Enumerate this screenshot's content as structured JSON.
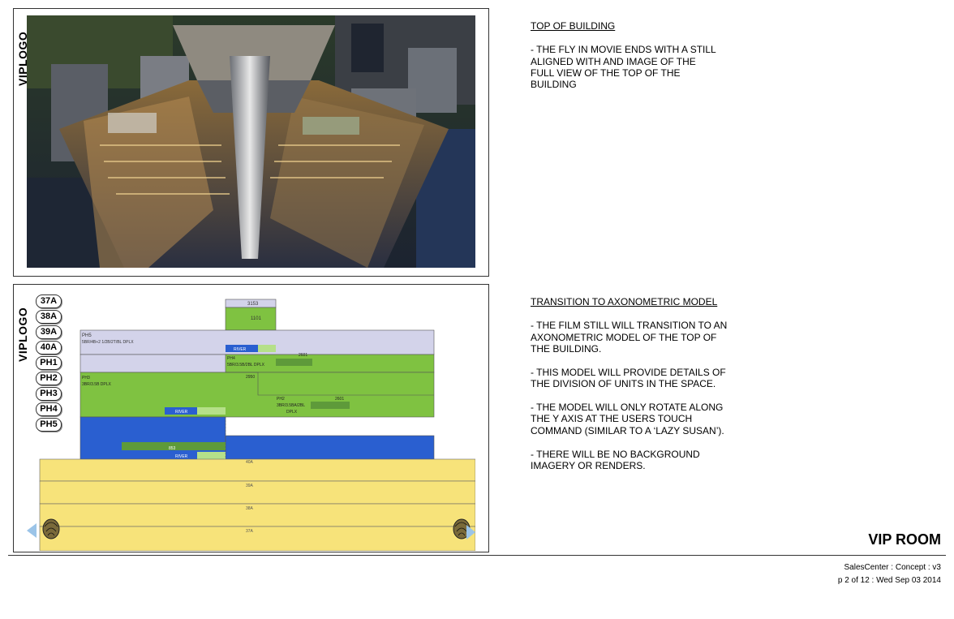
{
  "panels": {
    "top": {
      "logo": "VIPLOGO"
    },
    "bottom": {
      "logo": "VIPLOGO",
      "floors": [
        "37A",
        "38A",
        "39A",
        "40A",
        "PH1",
        "PH2",
        "PH3",
        "PH4",
        "PH5"
      ]
    }
  },
  "model_labels": {
    "top_unit": "3153",
    "top_unit_b": "1101",
    "ph5": "PH5",
    "ph5_desc": "5BR/4B+2 1/2B/2T/BL DPLX",
    "river1": "RIVER",
    "ph4": "PH4",
    "ph4_desc": "5BR/3.5B/2BL DPLX",
    "unit_2601a": "2601",
    "ph3": "PH3",
    "ph3_desc": "3BR/3.5B DPLX",
    "unit_2950": "2950",
    "ph2": "PH2",
    "ph2_desc": "3BR/3.5BA/2BL",
    "ph2_desc2": "DPLX",
    "unit_2601b": "2601",
    "river2": "RIVER",
    "unit_853": "853",
    "river3": "RIVER",
    "floor_40a": "40A",
    "floor_39a": "39A",
    "floor_38a": "38A",
    "floor_37a": "37A"
  },
  "notes": {
    "top": {
      "heading": "TOP OF BUILDING",
      "body": "-  THE FLY IN MOVIE ENDS WITH A STILL ALIGNED WITH AND IMAGE OF THE FULL VIEW OF THE TOP OF THE BUILDING"
    },
    "bottom": {
      "heading": "TRANSITION TO AXONOMETRIC MODEL",
      "body": "-  THE FILM STILL WILL TRANSITION TO AN AXONOMETRIC MODEL OF THE TOP OF THE BUILDING.\n\n- THIS MODEL WILL PROVIDE DETAILS OF THE DIVISION OF UNITS IN THE SPACE.\n\n- THE MODEL WILL ONLY ROTATE ALONG THE Y AXIS AT THE USERS TOUCH COMMAND (SIMILAR TO A ‘LAZY SUSAN’).\n\n- THERE WILL BE NO BACKGROUND IMAGERY OR RENDERS."
    }
  },
  "footer": {
    "title": "VIP ROOM",
    "concept": "SalesCenter : Concept : v3",
    "page": "p 2 of 12 : Wed Sep 03 2014"
  },
  "icons": [
    "left-rotate-arrow-icon",
    "right-rotate-arrow-icon",
    "fingerprint-icon"
  ],
  "colors": {
    "lavender": "#d3d3ea",
    "green": "#7fc241",
    "blue": "#2a5fd0",
    "yellow": "#f7e37a",
    "light_green": "#b5e089"
  }
}
